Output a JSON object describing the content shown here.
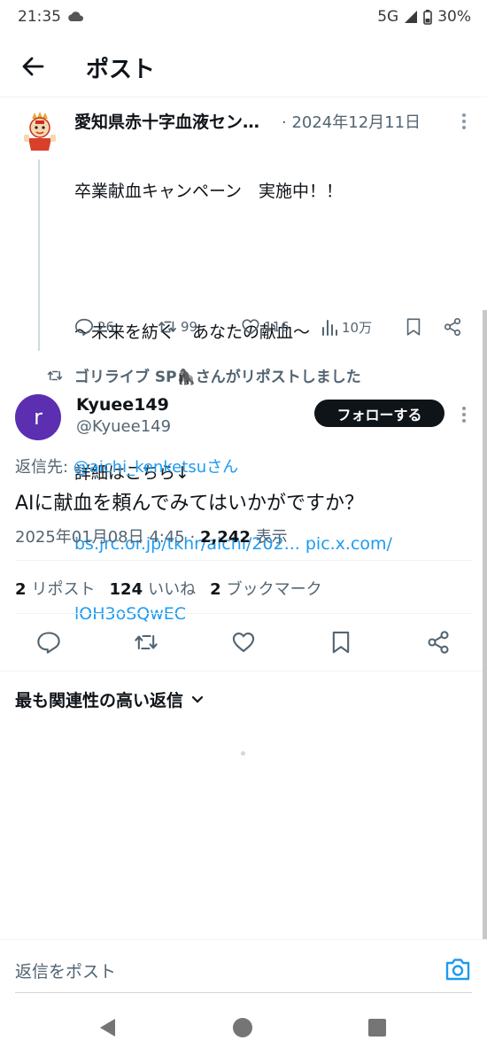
{
  "status_bar": {
    "time": "21:35",
    "network": "5G",
    "battery": "30%"
  },
  "header": {
    "title": "ポスト"
  },
  "quoted_post": {
    "author": "愛知県赤十字血液セン…",
    "date": "· 2024年12月11日",
    "lines": [
      "卒業献血キャンペーン　実施中！！",
      "",
      "〜未来を紡ぐ　あなたの献血〜",
      "",
      "詳細はこちら↓"
    ],
    "link1": "bs.jrc.or.jp/tkhr/aichi/202... pic.x.com/",
    "link2": "lOH3oSQwEC",
    "replies": "26",
    "reposts": "99",
    "likes": "116",
    "views": "10万"
  },
  "repost_notice": "ゴリライブ SP🦍さんがリポストしました",
  "post": {
    "avatar_letter": "r",
    "name": "Kyuee149",
    "handle": "@Kyuee149",
    "follow_label": "フォローする",
    "reply_to_prefix": "返信先: ",
    "reply_to_mention": "@aichi_kenketsuさん",
    "text": "AIに献血を頼んでみてはいかがですか？",
    "timestamp": "2025年01月08日 4:45 · ",
    "views_count": "2,242",
    "views_label": " 表示"
  },
  "stats": {
    "reposts_count": "2",
    "reposts_label": "リポスト",
    "likes_count": "124",
    "likes_label": "いいね",
    "bookmarks_count": "2",
    "bookmarks_label": "ブックマーク"
  },
  "replies_sort": {
    "label": "最も関連性の高い返信"
  },
  "composer": {
    "placeholder": "返信をポスト"
  },
  "colors": {
    "accent": "#1d9bf0",
    "avatar": "#5b2fb0",
    "text": "#0f1419",
    "secondary": "#536471"
  }
}
